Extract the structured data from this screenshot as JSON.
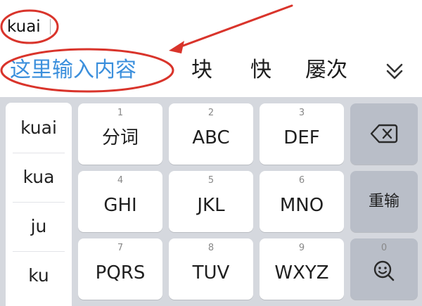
{
  "composition": {
    "text": "kuai"
  },
  "candidates": [
    {
      "label": "这里输入内容"
    },
    {
      "label": "块"
    },
    {
      "label": "快"
    },
    {
      "label": "屡次"
    }
  ],
  "icons": {
    "expand": "chevron-double-down-icon",
    "backspace": "backspace-icon",
    "emoji": "emoji-search-icon"
  },
  "keyboard": {
    "pinyin_options": [
      "kuai",
      "kua",
      "ju",
      "ku"
    ],
    "keys": [
      {
        "number": "1",
        "label": "分词"
      },
      {
        "number": "2",
        "label": "ABC"
      },
      {
        "number": "3",
        "label": "DEF"
      },
      {
        "number": "4",
        "label": "GHI"
      },
      {
        "number": "5",
        "label": "JKL"
      },
      {
        "number": "6",
        "label": "MNO"
      },
      {
        "number": "7",
        "label": "PQRS"
      },
      {
        "number": "8",
        "label": "TUV"
      },
      {
        "number": "9",
        "label": "WXYZ"
      }
    ],
    "function_keys": {
      "retype_label": "重输",
      "zero_number": "0"
    }
  },
  "colors": {
    "primary_candidate": "#3b8fdc",
    "annotation": "#d9342b",
    "keyboard_background": "#d5d8de",
    "function_key": "#b9bec8"
  }
}
